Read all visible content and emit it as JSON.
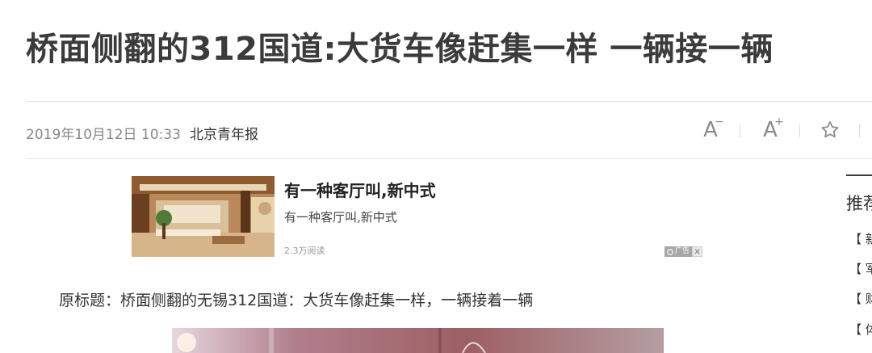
{
  "article": {
    "title": "桥面侧翻的312国道:大货车像赶集一样 一辆接一辆",
    "date": "2019年10月12日 10:33",
    "source": "北京青年报",
    "original_title": "原标题：桥面侧翻的无锡312国道：大货车像赶集一样，一辆接着一辆"
  },
  "toolbar": {
    "decrease_font_icon": "font-decrease-icon",
    "increase_font_icon": "font-increase-icon",
    "favorite_icon": "star-icon"
  },
  "ad": {
    "title": "有一种客厅叫,新中式",
    "subtitle": "有一种客厅叫,新中式",
    "reads": "2.3万阅读",
    "badge": "广告",
    "close": "✕"
  },
  "sidebar": {
    "heading": "推荐",
    "items": [
      {
        "label": "【 新"
      },
      {
        "label": "【 军"
      },
      {
        "label": "【 财"
      },
      {
        "label": "【 体"
      }
    ]
  },
  "colors": {
    "title": "#3b3b3b",
    "meta": "#888888",
    "divider": "#e4e4e4",
    "icon": "#8a8a8a"
  }
}
